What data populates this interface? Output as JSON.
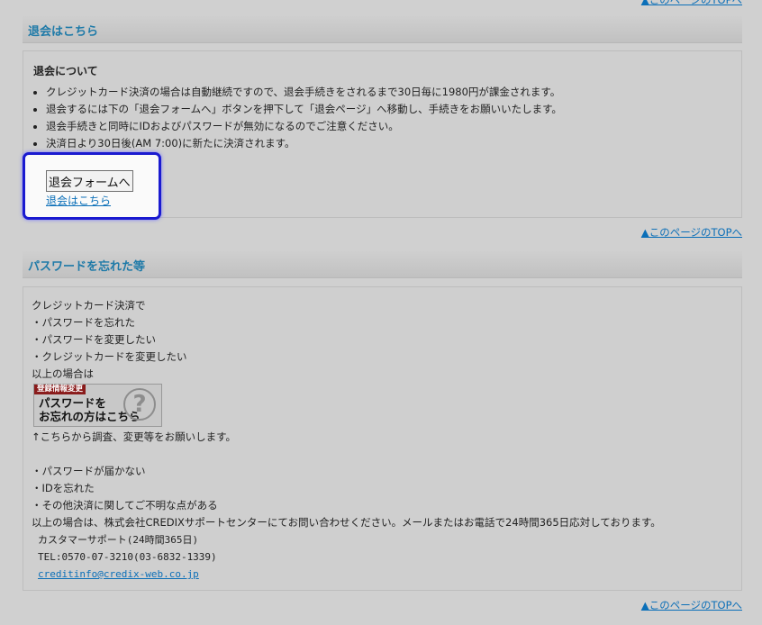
{
  "nav": {
    "page_top_link": "▲このページのTOPへ"
  },
  "withdraw": {
    "heading": "退会はこちら",
    "subtitle": "退会について",
    "notes": [
      "クレジットカード決済の場合は自動継続ですので、退会手続きをされるまで30日毎に1980円が課金されます。",
      "退会するには下の「退会フォームへ」ボタンを押下して「退会ページ」へ移動し、手続きをお願いいたします。",
      "退会手続きと同時にIDおよびパスワードが無効になるのでご注意ください。",
      "決済日より30日後(AM 7:00)に新たに決済されます。"
    ],
    "form_button": "退会フォームへ",
    "form_link": "退会はこちら"
  },
  "password": {
    "heading": "パスワードを忘れた等",
    "intro_lines": [
      "クレジットカード決済で",
      "・パスワードを忘れた",
      "・パスワードを変更したい",
      "・クレジットカードを変更したい",
      "以上の場合は"
    ],
    "banner": {
      "tag": "登録情報変更",
      "line1": "パスワードを",
      "line2": "お忘れの方はこちら",
      "icon": "question-mark-icon"
    },
    "after_banner": "↑こちらから調査、変更等をお願いします。",
    "other_lines": [
      "・パスワードが届かない",
      "・IDを忘れた",
      "・その他決済に関してご不明な点がある",
      "以上の場合は、株式会社CREDIXサポートセンターにてお問い合わせください。メールまたはお電話で24時間365日応対しております。"
    ],
    "support_name": "カスタマーサポート(24時間365日)",
    "support_tel": "TEL:0570-07-3210(03-6832-1339)",
    "support_email": "creditinfo@credix-web.co.jp"
  },
  "colors": {
    "heading": "#1e7aa8",
    "highlight_border": "#1a1ad0",
    "link": "#0b6fb8"
  }
}
